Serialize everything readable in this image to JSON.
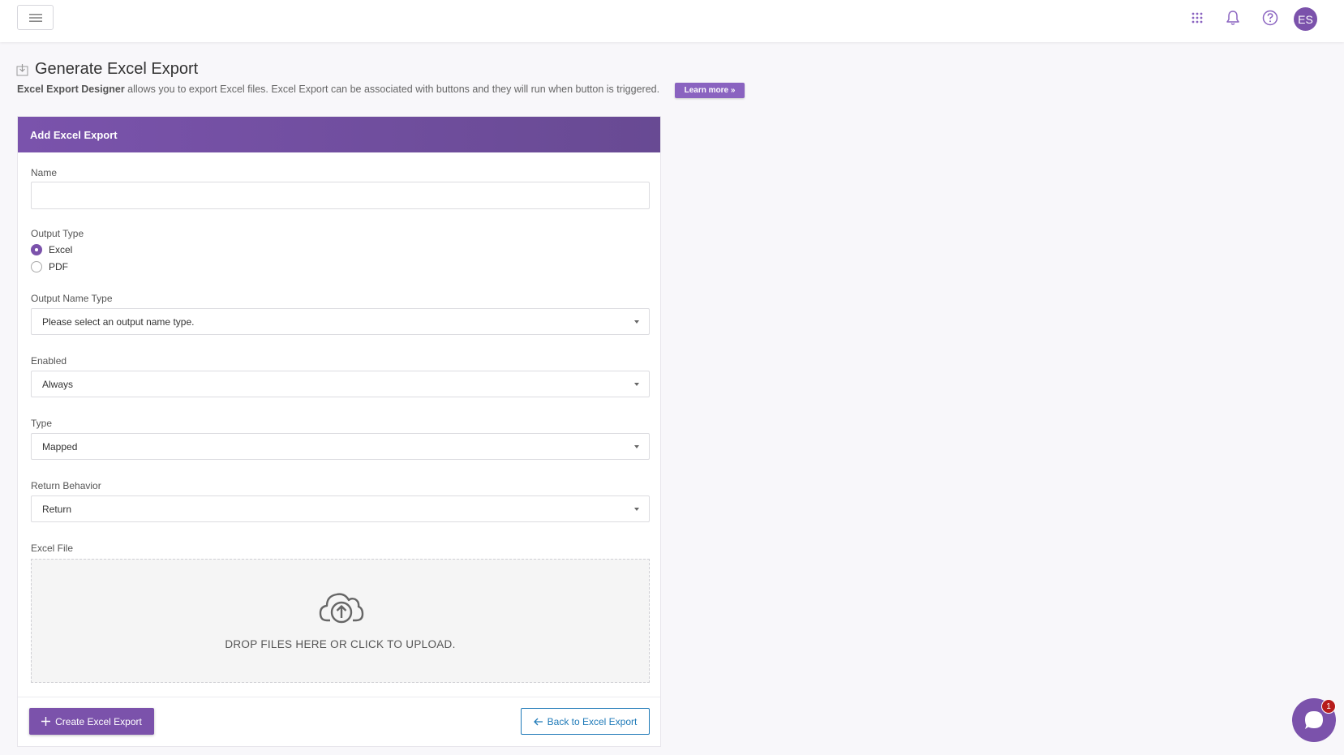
{
  "header": {
    "menu_icon": "hamburger-icon",
    "apps_icon": "grid-icon",
    "notifications_icon": "bell-icon",
    "help_icon": "help-icon",
    "avatar_initials": "ES",
    "accent": "#7b52ab"
  },
  "page": {
    "title": "Generate Excel Export",
    "title_icon": "download-icon",
    "subtitle_strong": "Excel Export Designer",
    "subtitle_rest": " allows you to export Excel files. Excel Export can be associated with buttons and they will run when button is triggered.",
    "learn_more": "Learn more »"
  },
  "form": {
    "header": "Add Excel Export",
    "name_label": "Name",
    "name_value": "",
    "output_type_label": "Output Type",
    "output_type_options": [
      "Excel",
      "PDF"
    ],
    "output_type_selected": "Excel",
    "output_name_type_label": "Output Name Type",
    "output_name_type_value": "Please select an output name type.",
    "enabled_label": "Enabled",
    "enabled_value": "Always",
    "type_label": "Type",
    "type_value": "Mapped",
    "return_behavior_label": "Return Behavior",
    "return_behavior_value": "Return",
    "excel_file_label": "Excel File",
    "dropzone_icon": "cloud-upload-icon",
    "dropzone_text": "DROP FILES HERE OR CLICK TO UPLOAD.",
    "create_button": "Create Excel Export",
    "back_button": "Back to Excel Export",
    "back_color": "#1f7ab8"
  },
  "chat": {
    "icon": "chat-icon",
    "badge_count": "1"
  }
}
